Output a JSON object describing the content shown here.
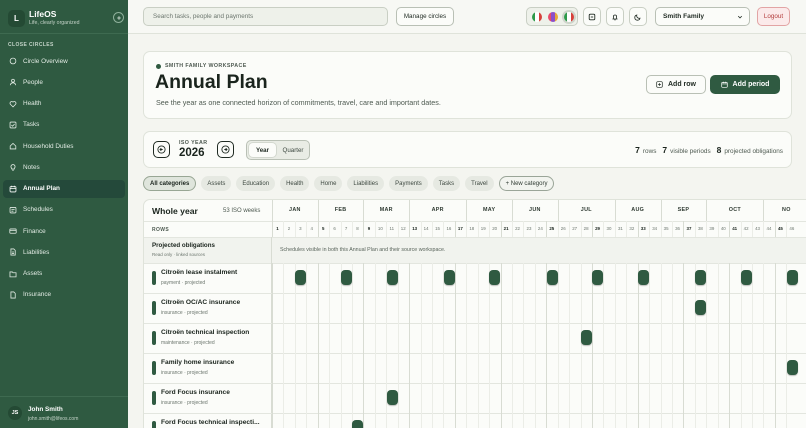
{
  "app": {
    "initial": "L",
    "name": "LifeOS",
    "tagline": "Life, clearly organized"
  },
  "sidebar": {
    "section_label": "CLOSE CIRCLES",
    "items": [
      {
        "label": "Circle Overview",
        "icon": "circle-icon"
      },
      {
        "label": "People",
        "icon": "people-icon"
      },
      {
        "label": "Health",
        "icon": "heart-icon"
      },
      {
        "label": "Tasks",
        "icon": "checkbox-icon"
      },
      {
        "label": "Household Duties",
        "icon": "home-icon"
      },
      {
        "label": "Notes",
        "icon": "lightbulb-icon"
      },
      {
        "label": "Annual Plan",
        "icon": "calendar-icon",
        "active": true
      },
      {
        "label": "Schedules",
        "icon": "schedule-icon"
      },
      {
        "label": "Finance",
        "icon": "card-icon"
      },
      {
        "label": "Liabilities",
        "icon": "document-icon"
      },
      {
        "label": "Assets",
        "icon": "folder-icon"
      },
      {
        "label": "Insurance",
        "icon": "file-icon"
      }
    ],
    "user": {
      "initials": "JS",
      "name": "John Smith",
      "email": "john.smith@lifeos.com"
    }
  },
  "topbar": {
    "search_placeholder": "Search tasks, people and payments",
    "manage_label": "Manage circles",
    "family_select": "Smith Family",
    "logout_label": "Logout",
    "flags": [
      {
        "colors": [
          "#2e9a4a",
          "#ffffff",
          "#d6403a"
        ]
      },
      {
        "colors": [
          "#e84b6a",
          "#8b4fc8",
          "#e8a83a"
        ]
      },
      {
        "colors": [
          "#2e9a4a",
          "#ffffff",
          "#d6403a"
        ]
      }
    ]
  },
  "hero": {
    "eyebrow": "SMITH FAMILY WORKSPACE",
    "title": "Annual Plan",
    "subtitle": "See the year as one connected horizon of commitments, travel, care and important dates.",
    "add_row_label": "Add row",
    "add_period_label": "Add period"
  },
  "yearbar": {
    "iso_label": "ISO YEAR",
    "year": "2026",
    "view_year": "Year",
    "view_quarter": "Quarter",
    "stats": {
      "rows": "7",
      "rows_label": "rows",
      "visible": "7",
      "visible_label": "visible periods",
      "projected": "8",
      "projected_label": "projected obligations"
    }
  },
  "categories": [
    "All categories",
    "Assets",
    "Education",
    "Health",
    "Home",
    "Liabilities",
    "Payments",
    "Tasks",
    "Travel",
    "+ New category"
  ],
  "grid": {
    "title": "Whole year",
    "weeks_count": "53 ISO weeks",
    "rows_label": "ROWS",
    "months": [
      {
        "label": "JAN",
        "start": 1,
        "weeks": 4
      },
      {
        "label": "FEB",
        "start": 5,
        "weeks": 4
      },
      {
        "label": "MAR",
        "start": 9,
        "weeks": 4
      },
      {
        "label": "APR",
        "start": 13,
        "weeks": 5
      },
      {
        "label": "MAY",
        "start": 18,
        "weeks": 4
      },
      {
        "label": "JUN",
        "start": 22,
        "weeks": 4
      },
      {
        "label": "JUL",
        "start": 26,
        "weeks": 5
      },
      {
        "label": "AUG",
        "start": 31,
        "weeks": 4
      },
      {
        "label": "SEP",
        "start": 35,
        "weeks": 4
      },
      {
        "label": "OCT",
        "start": 39,
        "weeks": 5
      },
      {
        "label": "NO",
        "start": 44,
        "weeks": 4
      }
    ],
    "week_numbers": [
      1,
      2,
      3,
      4,
      5,
      6,
      7,
      8,
      9,
      10,
      11,
      12,
      13,
      14,
      15,
      16,
      17,
      18,
      19,
      20,
      21,
      22,
      23,
      24,
      25,
      26,
      27,
      28,
      29,
      30,
      31,
      32,
      33,
      34,
      35,
      36,
      37,
      38,
      39,
      40,
      41,
      42,
      43,
      44,
      45,
      46
    ],
    "bold_weeks": [
      1,
      5,
      9,
      13,
      17,
      21,
      25,
      29,
      33,
      37,
      41,
      45
    ],
    "projected": {
      "title": "Projected obligations",
      "subtitle": "Read only · linked sources",
      "note": "Schedules visible in both this Annual Plan and their source workspace."
    },
    "rows": [
      {
        "title": "Citroën lease instalment",
        "subtitle": "payment · projected",
        "events": [
          3,
          7,
          11,
          16,
          20,
          25,
          29,
          33,
          38,
          42,
          46
        ]
      },
      {
        "title": "Citroën OC/AC insurance",
        "subtitle": "insurance · projected",
        "events": [
          38
        ]
      },
      {
        "title": "Citroën technical inspection",
        "subtitle": "maintenance · projected",
        "events": [
          28
        ]
      },
      {
        "title": "Family home insurance",
        "subtitle": "insurance · projected",
        "events": [
          46
        ]
      },
      {
        "title": "Ford Focus insurance",
        "subtitle": "insurance · projected",
        "events": [
          11
        ]
      },
      {
        "title": "Ford Focus technical inspecti...",
        "subtitle": "maintenance · projected",
        "events": [
          8
        ]
      }
    ]
  }
}
